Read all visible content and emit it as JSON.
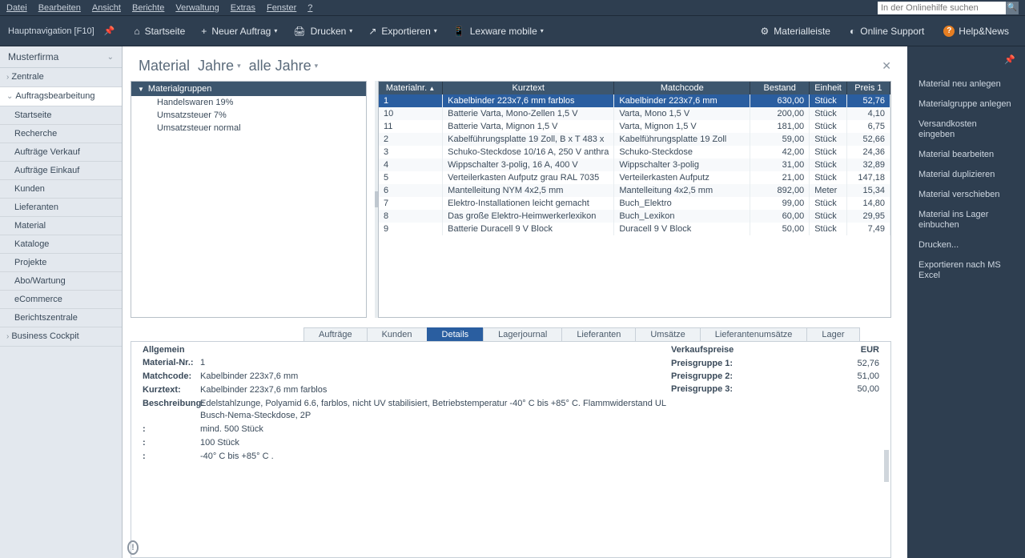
{
  "menubar": [
    "Datei",
    "Bearbeiten",
    "Ansicht",
    "Berichte",
    "Verwaltung",
    "Extras",
    "Fenster",
    "?"
  ],
  "search_placeholder": "In der Onlinehilfe suchen",
  "hauptnav": "Hauptnavigation [F10]",
  "toolbar": {
    "startseite": "Startseite",
    "neuer_auftrag": "Neuer Auftrag",
    "drucken": "Drucken",
    "exportieren": "Exportieren",
    "lexware_mobile": "Lexware mobile",
    "materialleiste": "Materialleiste",
    "online_support": "Online Support",
    "help_news": "Help&News"
  },
  "sidebar": {
    "header": "Musterfirma",
    "items": [
      {
        "label": "Zentrale",
        "parent": true
      },
      {
        "label": "Auftragsbearbeitung",
        "parent": true,
        "open": true,
        "active": true
      },
      {
        "label": "Startseite"
      },
      {
        "label": "Recherche"
      },
      {
        "label": "Aufträge Verkauf"
      },
      {
        "label": "Aufträge Einkauf"
      },
      {
        "label": "Kunden"
      },
      {
        "label": "Lieferanten"
      },
      {
        "label": "Material"
      },
      {
        "label": "Kataloge"
      },
      {
        "label": "Projekte"
      },
      {
        "label": "Abo/Wartung"
      },
      {
        "label": "eCommerce"
      },
      {
        "label": "Berichtszentrale"
      },
      {
        "label": "Business Cockpit",
        "parent": true
      }
    ]
  },
  "content": {
    "title": "Material",
    "filter1": "Jahre",
    "filter2": "alle Jahre"
  },
  "tree": {
    "header": "Materialgruppen",
    "items": [
      "Handelswaren 19%",
      "Umsatzsteuer 7%",
      "Umsatzsteuer normal"
    ]
  },
  "grid": {
    "headers": [
      "Materialnr.",
      "Kurztext",
      "Matchcode",
      "Bestand",
      "Einheit",
      "Preis 1"
    ],
    "rows": [
      {
        "nr": "1",
        "kurz": "Kabelbinder 223x7,6 mm farblos",
        "match": "Kabelbinder 223x7,6 mm",
        "best": "630,00",
        "einh": "Stück",
        "preis": "52,76",
        "sel": true
      },
      {
        "nr": "10",
        "kurz": "Batterie Varta, Mono-Zellen 1,5 V",
        "match": "Varta, Mono 1,5 V",
        "best": "200,00",
        "einh": "Stück",
        "preis": "4,10"
      },
      {
        "nr": "11",
        "kurz": "Batterie Varta, Mignon 1,5 V",
        "match": "Varta, Mignon 1,5 V",
        "best": "181,00",
        "einh": "Stück",
        "preis": "6,75"
      },
      {
        "nr": "2",
        "kurz": "Kabelführungsplatte 19 Zoll,  B x T 483 x",
        "match": "Kabelführungsplatte 19 Zoll",
        "best": "59,00",
        "einh": "Stück",
        "preis": "52,66"
      },
      {
        "nr": "3",
        "kurz": "Schuko-Steckdose 10/16 A, 250 V anthra",
        "match": "Schuko-Steckdose",
        "best": "42,00",
        "einh": "Stück",
        "preis": "24,36"
      },
      {
        "nr": "4",
        "kurz": "Wippschalter 3-polig, 16 A, 400 V",
        "match": "Wippschalter 3-polig",
        "best": "31,00",
        "einh": "Stück",
        "preis": "32,89"
      },
      {
        "nr": "5",
        "kurz": "Verteilerkasten Aufputz grau RAL 7035",
        "match": "Verteilerkasten Aufputz",
        "best": "21,00",
        "einh": "Stück",
        "preis": "147,18"
      },
      {
        "nr": "6",
        "kurz": "Mantelleitung NYM 4x2,5 mm",
        "match": "Mantelleitung 4x2,5 mm",
        "best": "892,00",
        "einh": "Meter",
        "preis": "15,34"
      },
      {
        "nr": "7",
        "kurz": "Elektro-Installationen leicht gemacht",
        "match": "Buch_Elektro",
        "best": "99,00",
        "einh": "Stück",
        "preis": "14,80"
      },
      {
        "nr": "8",
        "kurz": "Das große Elektro-Heimwerkerlexikon",
        "match": "Buch_Lexikon",
        "best": "60,00",
        "einh": "Stück",
        "preis": "29,95"
      },
      {
        "nr": "9",
        "kurz": "Batterie Duracell 9 V Block",
        "match": "Duracell 9 V Block",
        "best": "50,00",
        "einh": "Stück",
        "preis": "7,49"
      }
    ]
  },
  "tabs": [
    "Aufträge",
    "Kunden",
    "Details",
    "Lagerjournal",
    "Lieferanten",
    "Umsätze",
    "Lieferantenumsätze",
    "Lager"
  ],
  "active_tab": 2,
  "details": {
    "section1": "Allgemein",
    "section2": "Verkaufspreise",
    "eur": "EUR",
    "rows": [
      {
        "l": "Material-Nr.:",
        "v": "1"
      },
      {
        "l": "Matchcode:",
        "v": "Kabelbinder 223x7,6 mm"
      },
      {
        "l": "Kurztext:",
        "v": "Kabelbinder 223x7,6 mm farblos"
      },
      {
        "l": "Beschreibung:",
        "v": "Edelstahlzunge, Polyamid 6.6, farblos, nicht UV stabilisiert, Betriebstemperatur -40° C bis +85° C. Flammwiderstand UL Busch-Nema-Steckdose, 2P"
      },
      {
        "l": ":",
        "v": "mind. 500 Stück"
      },
      {
        "l": ":",
        "v": "100 Stück"
      },
      {
        "l": ":",
        "v": "-40° C bis +85° C ."
      }
    ],
    "prices": [
      {
        "l": "Preisgruppe 1:",
        "v": "52,76"
      },
      {
        "l": "Preisgruppe 2:",
        "v": "51,00"
      },
      {
        "l": "Preisgruppe 3:",
        "v": "50,00"
      }
    ]
  },
  "actions": [
    "Material neu anlegen",
    "Materialgruppe anlegen",
    "Versandkosten eingeben",
    "Material bearbeiten",
    "Material duplizieren",
    "Material verschieben",
    "Material ins Lager einbuchen",
    "Drucken...",
    "Exportieren nach MS Excel"
  ]
}
